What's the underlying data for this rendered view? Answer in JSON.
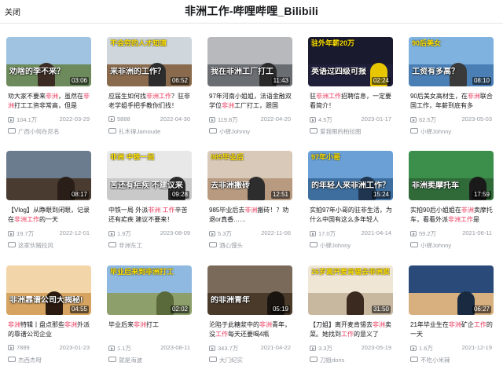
{
  "header": {
    "close_label": "关闭",
    "title": "非洲工作-哔哩哔哩_Bilibili"
  },
  "videos": [
    {
      "duration": "03:06",
      "title_parts": [
        "劝大家不要来",
        "非洲",
        "，虽然在",
        "非洲",
        "打工工资非常高，但是"
      ],
      "views": "104.1万",
      "date": "2022-03-29",
      "uploader": "广西小何在尼名",
      "caption": "劝啥的李不来？",
      "captop": "",
      "colors": [
        "#9fc3e0",
        "#6d8a5c",
        "#3b2b22"
      ]
    },
    {
      "duration": "06:52",
      "title_parts": [
        "应届生如何找",
        "非洲工作",
        "？驻非老学姐手把手教你们找！"
      ],
      "views": "5888",
      "date": "2022-04-30",
      "uploader": "扎木得Jamoude",
      "caption": "来非洲的工作？",
      "captop": "不会穷的人才知道",
      "colors": [
        "#cfd7dc",
        "#8a6a4d",
        "#2d2d2d"
      ]
    },
    {
      "duration": "11:43",
      "title_parts": [
        "97年河南小姐姐，法语金融双学位",
        "非洲",
        "工厂打工，跟国"
      ],
      "views": "119.8万",
      "date": "2022-04-20",
      "uploader": "小驿Johnny",
      "caption": "我在非洲工厂打工",
      "captop": "",
      "colors": [
        "#b7b9bd",
        "#6a6d72",
        "#2a2a2a"
      ]
    },
    {
      "duration": "02:24",
      "title_parts": [
        "驻",
        "非洲工作",
        "招聘信息，一定要看简介！"
      ],
      "views": "4.5万",
      "date": "2023-01-17",
      "uploader": "爱我眼的柏拉图",
      "caption": "英语过四级可报",
      "captop": "驻外年薪20万",
      "colors": [
        "#1a1a2e",
        "#1f1f3a",
        "#e8c700"
      ]
    },
    {
      "duration": "08:10",
      "title_parts": [
        "90后美女高材生，在",
        "非洲",
        "联合国工作，年薪到底有多"
      ],
      "views": "62.5万",
      "date": "2023-05-03",
      "uploader": "小驿Johnny",
      "caption": "工资有多高？",
      "captop": "90后美女",
      "colors": [
        "#7fb2df",
        "#4a7fb5",
        "#3a3a3a"
      ]
    },
    {
      "duration": "08:17",
      "title_parts": [
        "【Vlog】从睁眼到闭眼，记录在",
        "非洲工作",
        "的一天"
      ],
      "views": "19.7万",
      "date": "2022-12-01",
      "uploader": "这家伙贼拉风",
      "caption": "",
      "captop": "",
      "colors": [
        "#6b7c8f",
        "#4a3b30",
        "#2a1f18"
      ]
    },
    {
      "duration": "09:28",
      "title_parts": [
        "中铁一局 外派",
        "非洲",
        " ",
        "工作",
        "辛苦还有疟疾 建议不要来！"
      ],
      "views": "1.9万",
      "date": "2023-08-09",
      "uploader": "非洲东工",
      "caption": "苦还有疟疾 不建议来",
      "captop": "非洲  中铁一局",
      "colors": [
        "#e8e8e8",
        "#c9c9c9",
        "#2a2a2a"
      ]
    },
    {
      "duration": "12:51",
      "title_parts": [
        "985毕业后去",
        "非洲",
        "搬砖！？劝退or真香……"
      ],
      "views": "5.3万",
      "date": "2022-11-06",
      "uploader": "酒心馒头",
      "caption": "去非洲搬砖",
      "captop": "985毕业后",
      "colors": [
        "#d9c9b9",
        "#b89a80",
        "#2d2d2d"
      ]
    },
    {
      "duration": "15:24",
      "title_parts": [
        "实拍97年小哥的驻非生活，为什么中国有这么多年轻人"
      ],
      "views": "17.0万",
      "date": "2021-04-14",
      "uploader": "小驿Johnny",
      "caption": "的年轻人来非洲工作？",
      "captop": "97年小哥",
      "colors": [
        "#6aa0d6",
        "#3e6e9e",
        "#1f3550"
      ]
    },
    {
      "duration": "17:59",
      "title_parts": [
        "实拍90后小姐姐在",
        "非洲",
        "卖摩托车，看看外派",
        "非洲工作",
        "是"
      ],
      "views": "59.2万",
      "date": "2021-06-11",
      "uploader": "小驿Johnny",
      "caption": "非洲卖摩托车",
      "captop": "",
      "colors": [
        "#3c8f4a",
        "#2f6a38",
        "#1a1a1a"
      ]
    },
    {
      "duration": "04:55",
      "title_parts": [
        "非洲",
        "特辑丨盘点那些",
        "非洲",
        "外派的靠谱公司企业"
      ],
      "views": "7889",
      "date": "2023-01-23",
      "uploader": "杰西杰呀",
      "caption": "非洲靠谱公司大揭秘!",
      "captop": "",
      "colors": [
        "#f2d5a8",
        "#d6a460",
        "#2a1a10"
      ]
    },
    {
      "duration": "02:02",
      "title_parts": [
        "毕业后来",
        "非洲",
        "打工"
      ],
      "views": "1.1万",
      "date": "2023-08-11",
      "uploader": "就是海波",
      "caption": "",
      "captop": "毕业后来到非洲打工",
      "colors": [
        "#8fb9e0",
        "#8d9f6a",
        "#5a6a3a"
      ]
    },
    {
      "duration": "05:19",
      "title_parts": [
        "沦陷于此糖浆中的",
        "非洲",
        "青年，没",
        "工作",
        "每天还要喝4瓶"
      ],
      "views": "343.7万",
      "date": "2021-04-22",
      "uploader": "大门纪实",
      "caption": "的非洲青年",
      "captop": "",
      "colors": [
        "#7a6a5a",
        "#4a3a2a",
        "#1a1410"
      ]
    },
    {
      "duration": "31:50",
      "title_parts": [
        "【刀姐】离开麦肯锡去",
        "非洲",
        "卖菜。她找到",
        "工作",
        "的意义了"
      ],
      "views": "3.3万",
      "date": "2023-05-19",
      "uploader": "刀姐doris",
      "caption": "",
      "captop": "26岁离开麦肯锡去非洲卖菜",
      "colors": [
        "#f0e6d6",
        "#c9b8a0",
        "#3a2a20"
      ]
    },
    {
      "duration": "06:27",
      "title_parts": [
        "21年毕业生在",
        "非洲",
        "矿企",
        "工作",
        "的一天"
      ],
      "views": "1.6万",
      "date": "2021-12-19",
      "uploader": "不吃小米辣",
      "caption": "",
      "captop": "",
      "colors": [
        "#2a4a7a",
        "#d8b080",
        "#1a2a40"
      ]
    }
  ],
  "highlight_color": "#e8375b"
}
